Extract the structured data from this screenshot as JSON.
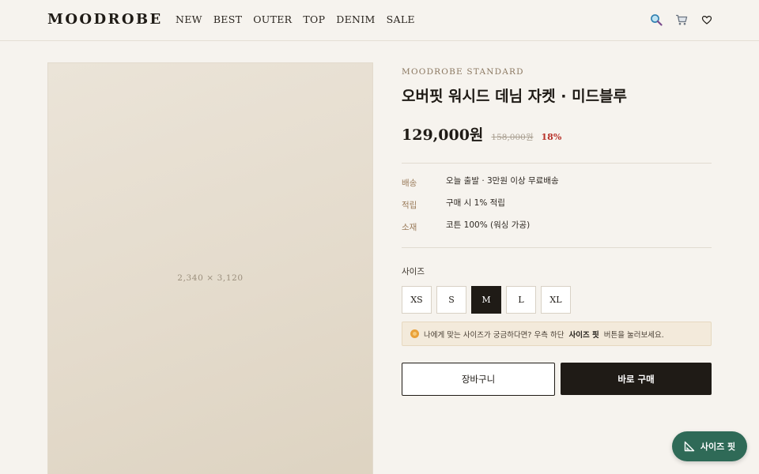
{
  "header": {
    "logo": "MOODROBE",
    "nav": [
      "NEW",
      "BEST",
      "OUTER",
      "TOP",
      "DENIM",
      "SALE"
    ],
    "icons": [
      "search-icon",
      "cart-icon",
      "heart-icon"
    ]
  },
  "gallery": {
    "image_label": "2,340 × 3,120"
  },
  "product": {
    "brand": "MOODROBE STANDARD",
    "title": "오버핏 워시드 데님 자켓 · 미드블루",
    "price": "129,000원",
    "original_price": "158,000원",
    "discount": "18%",
    "specs": [
      {
        "label": "배송",
        "value": "오늘 출발 · 3만원 이상 무료배송"
      },
      {
        "label": "적립",
        "value": "구매 시 1% 적립"
      },
      {
        "label": "소재",
        "value": "코튼 100% (워싱 가공)"
      }
    ]
  },
  "size": {
    "label": "사이즈",
    "options": [
      "XS",
      "S",
      "M",
      "L",
      "XL"
    ],
    "selected": "M"
  },
  "fit_note": {
    "before": "나에게 맞는 사이즈가 궁금하다면? 우측 하단",
    "highlight": "사이즈 핏",
    "after": "버튼을 눌러보세요."
  },
  "actions": {
    "cart_label": "장바구니",
    "buy_label": "바로 구매"
  },
  "fab": {
    "label": "사이즈 핏"
  },
  "colors": {
    "background": "#f6f3ee",
    "primary": "#1f1b16",
    "discount": "#b8322a",
    "fab": "#2f6a57"
  }
}
